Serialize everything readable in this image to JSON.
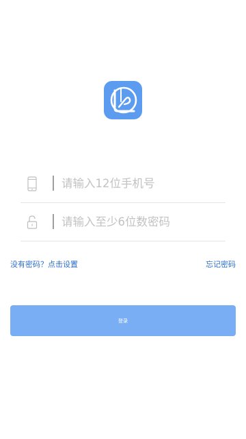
{
  "app": {
    "logo_icon": "app-logo-icon",
    "brand_color": "#5b9cf0"
  },
  "form": {
    "phone": {
      "icon": "mobile-phone-icon",
      "value": "",
      "placeholder": "请输入12位手机号"
    },
    "password": {
      "icon": "unlock-icon",
      "value": "",
      "placeholder": "请输入至少6位数密码"
    }
  },
  "links": {
    "no_password": "没有密码？点击设置",
    "forgot_password": "忘记密码"
  },
  "login_button": {
    "label": "登录",
    "color": "#7aaef4"
  },
  "colors": {
    "link": "#2f6fcb",
    "placeholder": "#c2c2c2",
    "divider": "#e4e4e4"
  }
}
